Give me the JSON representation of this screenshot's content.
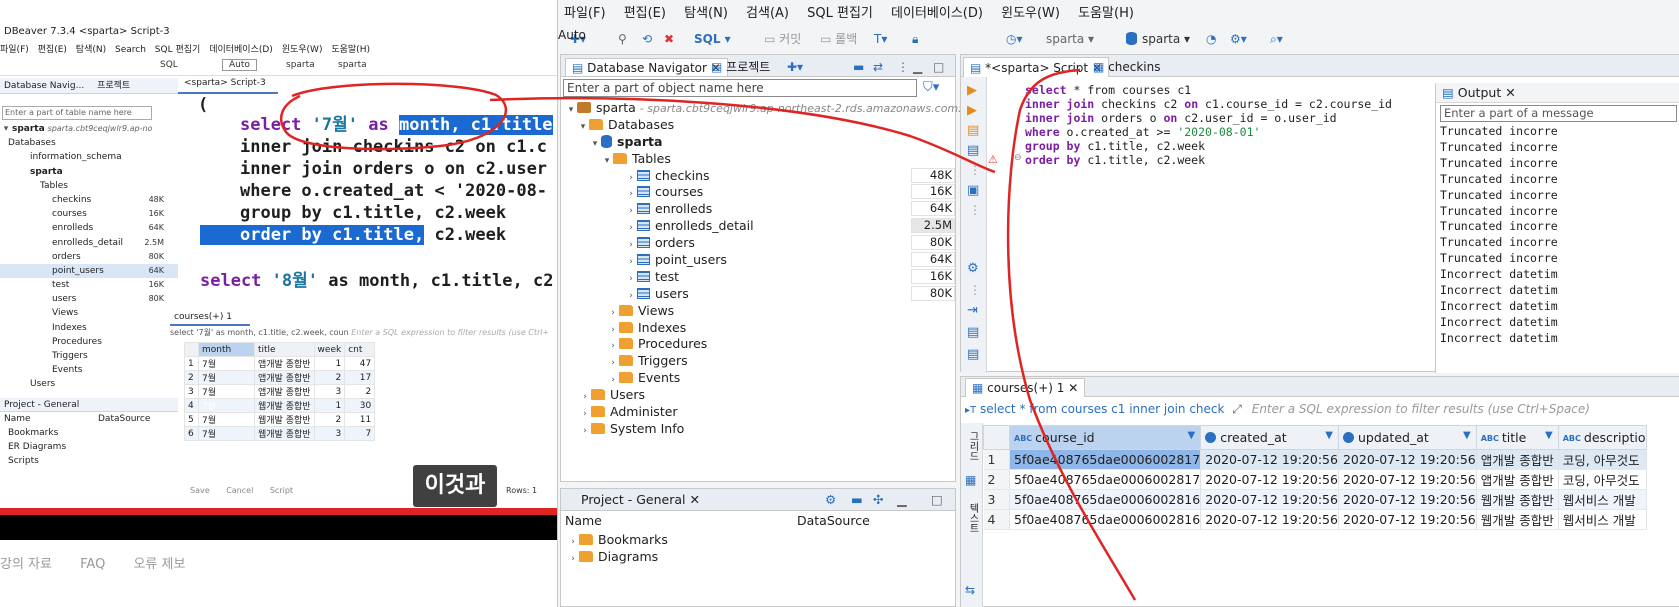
{
  "left_window": {
    "title": "DBeaver 7.3.4   <sparta> Script-3",
    "menu": [
      "파일(F)",
      "편집(E)",
      "탐색(N)",
      "Search",
      "SQL 편집기",
      "데이터베이스(D)",
      "윈도우(W)",
      "도움말(H)"
    ],
    "toolbar": {
      "sql": "SQL",
      "auto": "Auto",
      "db1": "sparta",
      "db2": "sparta"
    },
    "nav_tabs": [
      "Database Navig...",
      "프로젝트"
    ],
    "nav_filter_placeholder": "Enter a part of table name here",
    "connection": {
      "name": "sparta",
      "host": "sparta.cbt9ceqjwlr9.ap-no"
    },
    "tree": [
      {
        "label": "Databases",
        "indent": 1
      },
      {
        "label": "information_schema",
        "indent": 2
      },
      {
        "label": "sparta",
        "indent": 2
      },
      {
        "label": "Tables",
        "indent": 3
      },
      {
        "label": "checkins",
        "indent": 4,
        "count": "48K"
      },
      {
        "label": "courses",
        "indent": 4,
        "count": "16K"
      },
      {
        "label": "enrolleds",
        "indent": 4,
        "count": "64K"
      },
      {
        "label": "enrolleds_detail",
        "indent": 4,
        "count": "2.5M"
      },
      {
        "label": "orders",
        "indent": 4,
        "count": "80K"
      },
      {
        "label": "point_users",
        "indent": 4,
        "count": "64K"
      },
      {
        "label": "test",
        "indent": 4,
        "count": "16K"
      },
      {
        "label": "users",
        "indent": 4,
        "count": "80K"
      },
      {
        "label": "Views",
        "indent": 3
      },
      {
        "label": "Indexes",
        "indent": 3
      },
      {
        "label": "Procedures",
        "indent": 3
      },
      {
        "label": "Triggers",
        "indent": 3
      },
      {
        "label": "Events",
        "indent": 3
      },
      {
        "label": "Users",
        "indent": 1
      }
    ],
    "project": {
      "header": "Project - General",
      "col_name": "Name",
      "col_ds": "DataSource",
      "items": [
        "Bookmarks",
        "ER Diagrams",
        "Scripts"
      ]
    },
    "editor_tab": "<sparta> Script-3",
    "code": {
      "open_paren": "(",
      "l1_kw": "select",
      "l1_str": "'7월'",
      "l1_as": "as",
      "l1_sel": "month, c1.title",
      "l2": "inner join checkins c2 on c1.c",
      "l3": "inner join orders o on c2.user",
      "l4": "where o.created_at < '2020-08-",
      "l5": "group by c1.title, c2.week",
      "l6a": "order by c1.title,",
      "l6b": " c2.week",
      "l7_kw": "select",
      "l7_str": "'8월'",
      "l7_rest": " as month, c1.title, c2"
    },
    "result_tab": "courses(+) 1",
    "result_filter": "select '7월' as month, c1.title, c2.week, coun",
    "result_filter_hint": "Enter a SQL expression to filter results (use Ctrl+",
    "grid_headers": [
      "month",
      "title",
      "week",
      "cnt"
    ],
    "grid_rows": [
      [
        "1",
        "7월",
        "앱개발 종합반",
        "1",
        "47"
      ],
      [
        "2",
        "7월",
        "앱개발 종합반",
        "2",
        "17"
      ],
      [
        "3",
        "7월",
        "앱개발 종합반",
        "3",
        "2"
      ],
      [
        "4",
        "7월",
        "웹개발 종합반",
        "1",
        "30"
      ],
      [
        "5",
        "7월",
        "웹개발 종합반",
        "2",
        "11"
      ],
      [
        "6",
        "7월",
        "웹개발 종합반",
        "3",
        "7"
      ]
    ],
    "bottom": {
      "save": "Save",
      "cancel": "Cancel",
      "script": "Script",
      "rows": "Rows: 1"
    },
    "caption": "이것과",
    "footer": [
      "강의 자료",
      "FAQ",
      "오류 제보"
    ]
  },
  "right_window": {
    "menu": [
      "파일(F)",
      "편집(E)",
      "탐색(N)",
      "검색(A)",
      "SQL 편집기",
      "데이터베이스(D)",
      "윈도우(W)",
      "도움말(H)"
    ],
    "toolbar": {
      "sql": "SQL",
      "commit": "커밋",
      "rollback": "롤백",
      "auto": "Auto",
      "db1": "sparta",
      "db2": "sparta"
    },
    "nav_tabs": [
      "Database Navigator",
      "프로젝트"
    ],
    "nav_filter_placeholder": "Enter a part of object name here",
    "connection": {
      "name": "sparta",
      "host": "- sparta.cbt9ceqjwlr9.ap-northeast-2.rds.amazonaws.com:3306"
    },
    "tree": [
      {
        "label": "Databases",
        "indent": 1,
        "icon": "folder"
      },
      {
        "label": "sparta",
        "indent": 2,
        "icon": "db",
        "bold": true
      },
      {
        "label": "Tables",
        "indent": 3,
        "icon": "folder"
      },
      {
        "label": "checkins",
        "indent": 4,
        "icon": "table",
        "count": "48K"
      },
      {
        "label": "courses",
        "indent": 4,
        "icon": "table",
        "count": "16K"
      },
      {
        "label": "enrolleds",
        "indent": 4,
        "icon": "table",
        "count": "64K"
      },
      {
        "label": "enrolleds_detail",
        "indent": 4,
        "icon": "table",
        "count": "2.5M"
      },
      {
        "label": "orders",
        "indent": 4,
        "icon": "table",
        "count": "80K"
      },
      {
        "label": "point_users",
        "indent": 4,
        "icon": "table",
        "count": "64K"
      },
      {
        "label": "test",
        "indent": 4,
        "icon": "table",
        "count": "16K"
      },
      {
        "label": "users",
        "indent": 4,
        "icon": "table",
        "count": "80K"
      },
      {
        "label": "Views",
        "indent": 3,
        "icon": "folder"
      },
      {
        "label": "Indexes",
        "indent": 3,
        "icon": "folder"
      },
      {
        "label": "Procedures",
        "indent": 3,
        "icon": "folder"
      },
      {
        "label": "Triggers",
        "indent": 3,
        "icon": "folder"
      },
      {
        "label": "Events",
        "indent": 3,
        "icon": "folder"
      },
      {
        "label": "Users",
        "indent": 1,
        "icon": "folder"
      },
      {
        "label": "Administer",
        "indent": 1,
        "icon": "folder"
      },
      {
        "label": "System Info",
        "indent": 1,
        "icon": "folder"
      }
    ],
    "project": {
      "header": "Project - General",
      "col_name": "Name",
      "col_ds": "DataSource",
      "items": [
        "Bookmarks",
        "Diagrams"
      ]
    },
    "editor_tabs": [
      "*<sparta> Script",
      "checkins"
    ],
    "sql": {
      "l1a": "select ",
      "l1b": "*",
      "l1c": " from courses c1",
      "l2a": "inner join",
      "l2b": " checkins c2 ",
      "l2c": "on",
      "l2d": " c1.course_id = c2.course_id",
      "l3a": "inner join",
      "l3b": " orders o ",
      "l3c": "on",
      "l3d": " c2.user_id = o.user_id",
      "l4a": "where",
      "l4b": " o.created_at >= ",
      "l4c": "'2020-08-01'",
      "l5a": "group by",
      "l5b": " c1.title, c2.week",
      "l6a": "order by",
      "l6b": " c1.title, c2.week"
    },
    "output": {
      "title": "Output",
      "filter_placeholder": "Enter a part of a message",
      "messages": [
        "Truncated incorre",
        "Truncated incorre",
        "Truncated incorre",
        "Truncated incorre",
        "Truncated incorre",
        "Truncated incorre",
        "Truncated incorre",
        "Truncated incorre",
        "Truncated incorre",
        "Incorrect datetim",
        "Incorrect datetim",
        "Incorrect datetim",
        "Incorrect datetim",
        "Incorrect datetim"
      ]
    },
    "result_tab": "courses(+) 1",
    "result_query": "select * from courses c1 inner join check",
    "result_filter_hint": "Enter a SQL expression to filter results (use Ctrl+Space)",
    "columns": [
      "course_id",
      "created_at",
      "updated_at",
      "title",
      "descriptio"
    ],
    "rows": [
      [
        "1",
        "5f0ae408765dae0006002817",
        "2020-07-12 19:20:56",
        "2020-07-12 19:20:56",
        "앱개발 종합반",
        "코딩, 아무것도"
      ],
      [
        "2",
        "5f0ae408765dae0006002817",
        "2020-07-12 19:20:56",
        "2020-07-12 19:20:56",
        "앱개발 종합반",
        "코딩, 아무것도"
      ],
      [
        "3",
        "5f0ae408765dae0006002816",
        "2020-07-12 19:20:56",
        "2020-07-12 19:20:56",
        "웹개발 종합반",
        "웹서비스 개발"
      ],
      [
        "4",
        "5f0ae408765dae0006002816",
        "2020-07-12 19:20:56",
        "2020-07-12 19:20:56",
        "웹개발 종합반",
        "웹서비스 개발"
      ]
    ]
  }
}
